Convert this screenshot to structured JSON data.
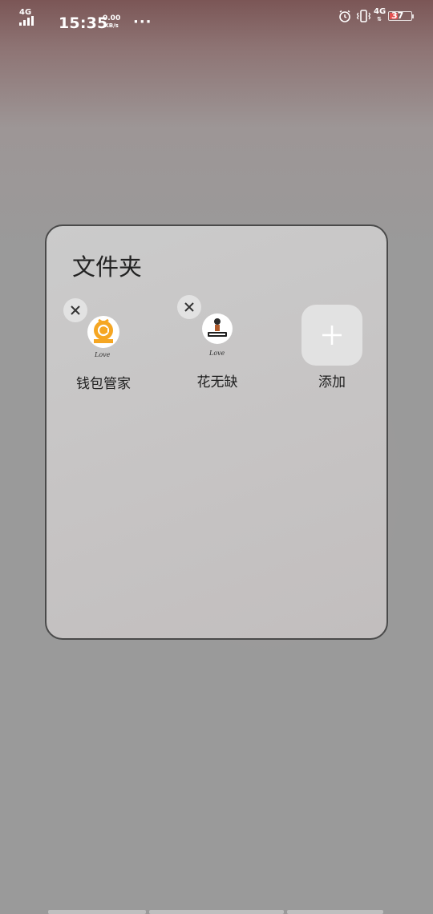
{
  "status_bar": {
    "network_left": "4G",
    "time": "15:35",
    "speed_value": "0.00",
    "speed_unit": "KB/s",
    "more": "···",
    "network_right": "4G",
    "battery_level": "37",
    "icons": [
      "signal-icon",
      "alarm-icon",
      "vibrate-icon",
      "battery-icon"
    ]
  },
  "folder": {
    "title": "文件夹",
    "apps": [
      {
        "label": "钱包管家",
        "icon": "wallet-app-icon",
        "caption": "Love",
        "accent": "#f5a623"
      },
      {
        "label": "花无缺",
        "icon": "huawuque-app-icon",
        "caption": "Love"
      }
    ],
    "add_label": "添加"
  }
}
